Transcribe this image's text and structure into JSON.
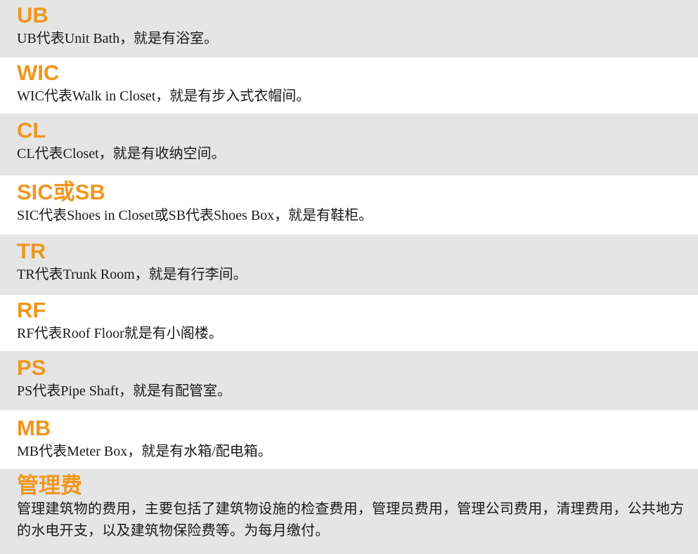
{
  "entries": [
    {
      "term": "UB",
      "description": "UB代表Unit Bath，就是有浴室。"
    },
    {
      "term": "WIC",
      "description": "WIC代表Walk in Closet，就是有步入式衣帽间。"
    },
    {
      "term": "CL",
      "description": "CL代表Closet，就是有收纳空间。"
    },
    {
      "term": "SIC或SB",
      "description": "SIC代表Shoes in Closet或SB代表Shoes Box，就是有鞋柜。"
    },
    {
      "term": "TR",
      "description": "TR代表Trunk Room，就是有行李间。"
    },
    {
      "term": "RF",
      "description": "RF代表Roof Floor就是有小阁楼。"
    },
    {
      "term": "PS",
      "description": "PS代表Pipe Shaft，就是有配管室。"
    },
    {
      "term": "MB",
      "description": "MB代表Meter Box，就是有水箱/配电箱。"
    },
    {
      "term": "管理费",
      "description": "管理建筑物的费用，主要包括了建筑物设施的检查费用，管理员费用，管理公司费用，清理费用，公共地方的水电开支，以及建筑物保险费等。为每月缴付。"
    }
  ],
  "colors": {
    "heading": "#f0961e",
    "stripe": "#e5e5e5",
    "text": "#1a1a1a"
  }
}
